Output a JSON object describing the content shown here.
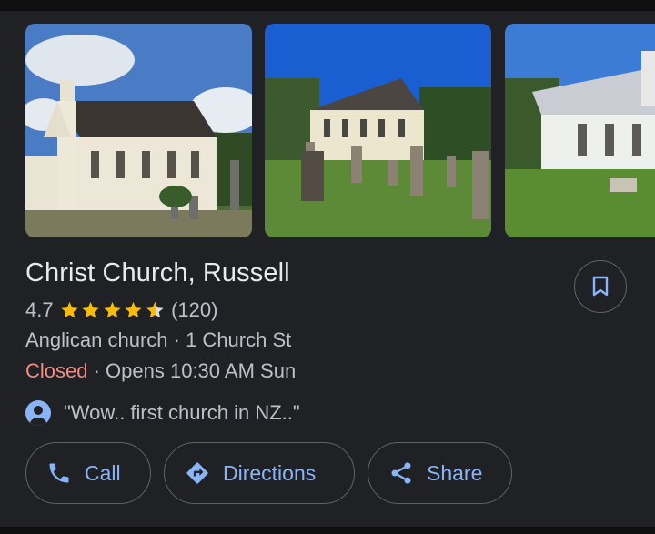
{
  "place": {
    "name": "Christ Church, Russell",
    "rating": "4.7",
    "rating_stars": 4.7,
    "review_count": "(120)",
    "category_address": "Anglican church · 1 Church St",
    "status": "Closed",
    "opens": "· Opens 10:30 AM Sun",
    "review_snippet": "\"Wow.. first church in NZ..\""
  },
  "actions": {
    "call": "Call",
    "directions": "Directions",
    "share": "Share"
  },
  "colors": {
    "accent": "#8ab4f8",
    "star": "#fbbc04",
    "closed": "#f28b82",
    "background": "#202124"
  },
  "icons": {
    "save": "bookmark-icon",
    "call": "phone-icon",
    "directions": "directions-icon",
    "share": "share-icon",
    "reviewer": "person-avatar-icon"
  }
}
